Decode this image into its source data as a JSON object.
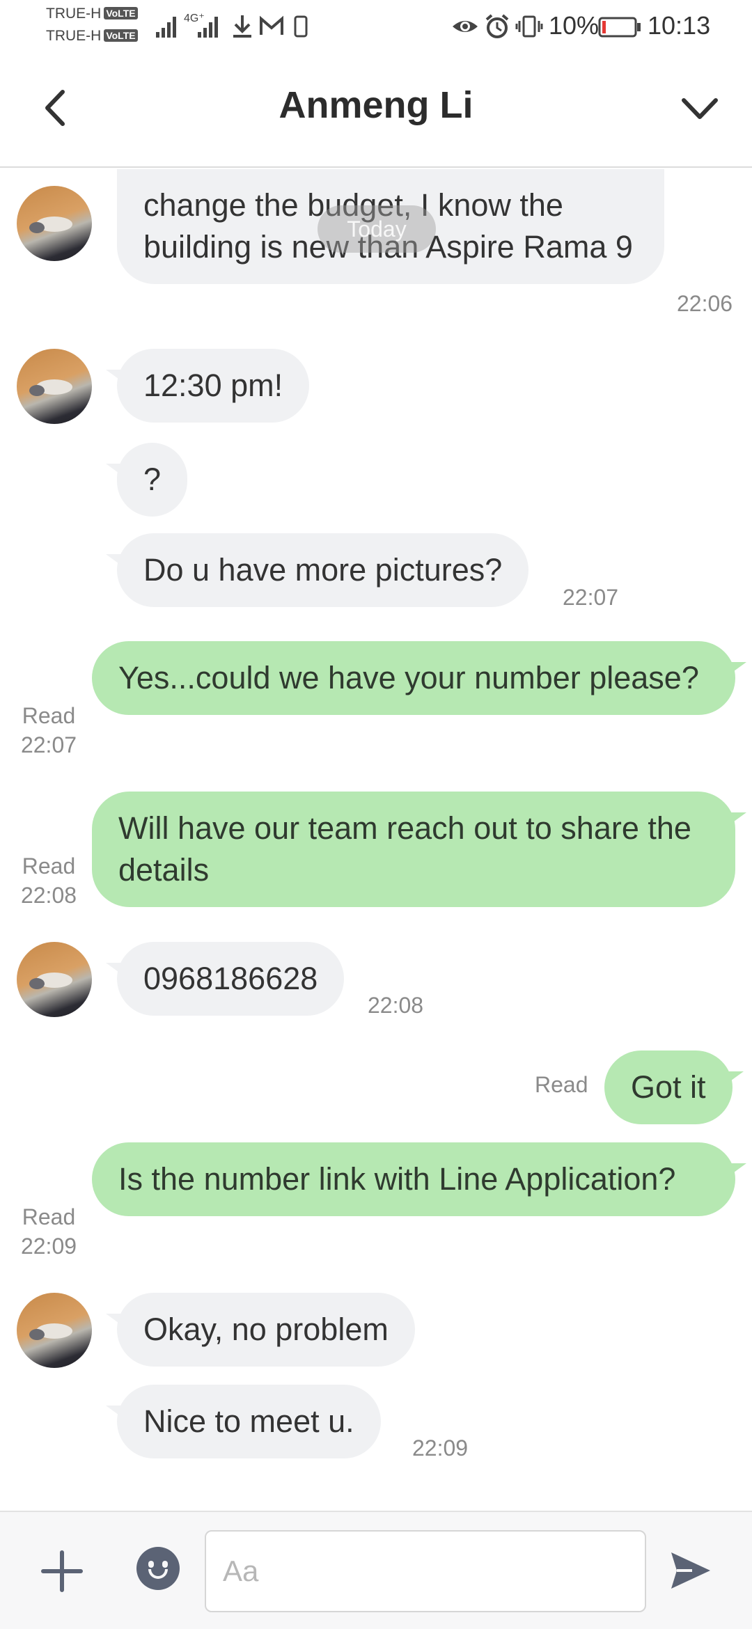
{
  "status_bar": {
    "carrier_1": "TRUE-H",
    "carrier_2": "TRUE-H",
    "volte_badge": "VoLTE",
    "network_type": "4G⁺",
    "battery_percent": "10%",
    "time": "10:13"
  },
  "header": {
    "title": "Anmeng Li"
  },
  "chat": {
    "date_separator": "Today",
    "messages": [
      {
        "dir": "in",
        "text": "change the budget, I know the building is new than Aspire Rama 9",
        "time": "22:06"
      },
      {
        "dir": "in",
        "text": "12:30 pm!"
      },
      {
        "dir": "in",
        "text": "?"
      },
      {
        "dir": "in",
        "text": "Do u have more pictures?",
        "time": "22:07"
      },
      {
        "dir": "out",
        "text": "Yes...could we have your number please?",
        "read": "Read",
        "time": "22:07"
      },
      {
        "dir": "out",
        "text": "Will have our team reach out to share the details",
        "read": "Read",
        "time": "22:08"
      },
      {
        "dir": "in",
        "text": "0968186628",
        "time": "22:08"
      },
      {
        "dir": "out",
        "text": "Got it",
        "read": "Read"
      },
      {
        "dir": "out",
        "text": "Is the number link with Line Application?",
        "read": "Read",
        "time": "22:09"
      },
      {
        "dir": "in",
        "text": "Okay, no problem"
      },
      {
        "dir": "in",
        "text": "Nice to meet u.",
        "time": "22:09"
      }
    ]
  },
  "input_bar": {
    "placeholder": "Aa"
  },
  "colors": {
    "incoming_bubble": "#f0f1f3",
    "outgoing_bubble": "#b6e8b2",
    "icon_gray": "#5b6375",
    "battery_low": "#e53935"
  }
}
